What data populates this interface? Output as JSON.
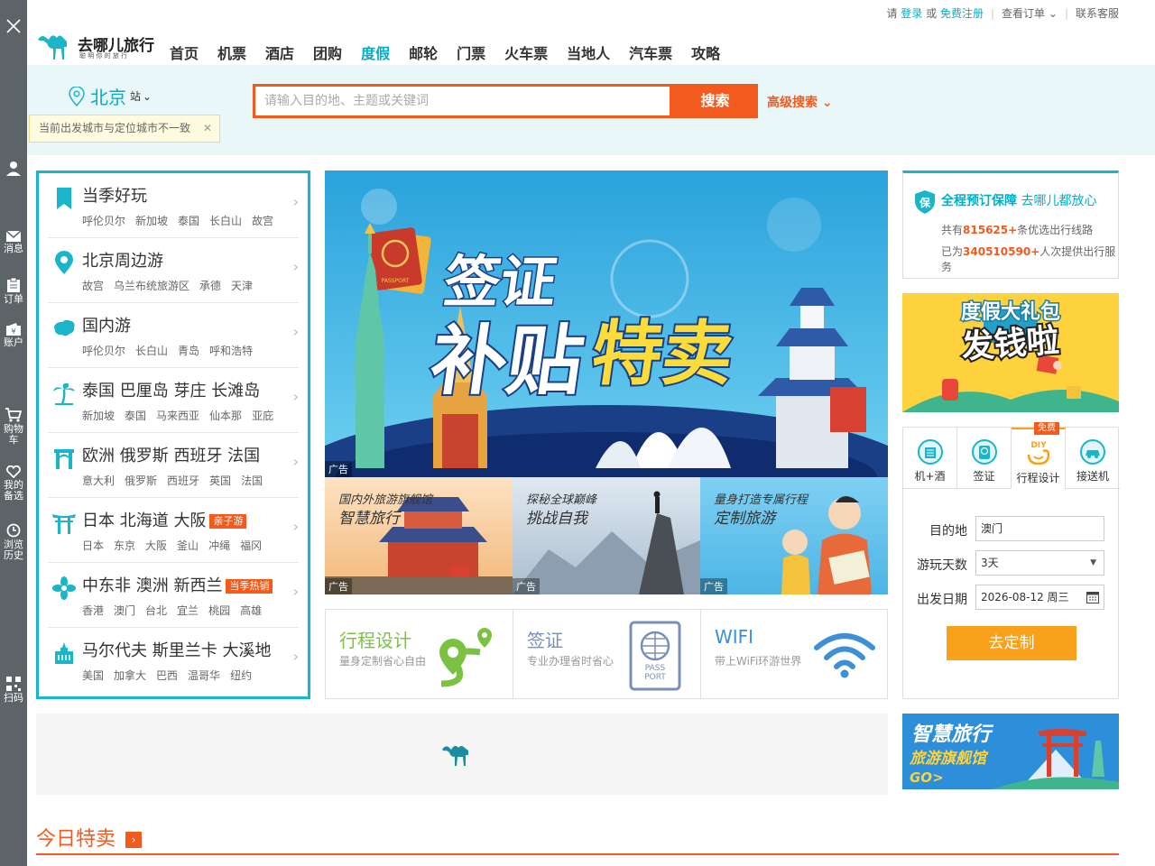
{
  "sidebar": {
    "items": [
      {
        "label": "消息",
        "icon": "mail-icon"
      },
      {
        "label": "订单",
        "icon": "clipboard-icon"
      },
      {
        "label": "账户",
        "icon": "wallet-icon"
      },
      {
        "label": "购物车",
        "icon": "cart-icon"
      },
      {
        "label": "我的备选",
        "icon": "heart-icon"
      },
      {
        "label": "浏览历史",
        "icon": "clock-icon"
      },
      {
        "label": "扫码",
        "icon": "qr-icon"
      }
    ]
  },
  "toplinks": {
    "please": "请",
    "login": "登录",
    "or": "或",
    "register": "免费注册",
    "orders": "查看订单",
    "service": "联系客服"
  },
  "logo": {
    "name": "去哪儿旅行",
    "slogan": "聪 明 你 的 旅 行"
  },
  "nav": [
    "首页",
    "机票",
    "酒店",
    "团购",
    "度假",
    "邮轮",
    "门票",
    "火车票",
    "当地人",
    "汽车票",
    "攻略"
  ],
  "nav_active": "度假",
  "city": {
    "name": "北京",
    "suffix": "站",
    "tip": "当前出发城市与定位城市不一致"
  },
  "search": {
    "placeholder": "请输入目的地、主题或关键词",
    "button": "搜索",
    "advanced": "高级搜索"
  },
  "categories": [
    {
      "title": "当季好玩",
      "badge": "",
      "subs": [
        "呼伦贝尔",
        "新加坡",
        "泰国",
        "长白山",
        "故宫"
      ]
    },
    {
      "title": "北京周边游",
      "badge": "",
      "subs": [
        "故宫",
        "乌兰布统旅游区",
        "承德",
        "天津"
      ]
    },
    {
      "title": "国内游",
      "badge": "",
      "subs": [
        "呼伦贝尔",
        "长白山",
        "青岛",
        "呼和浩特"
      ]
    },
    {
      "title": "泰国 巴厘岛 芽庄 长滩岛",
      "badge": "",
      "subs": [
        "新加坡",
        "泰国",
        "马来西亚",
        "仙本那",
        "亚庇"
      ]
    },
    {
      "title": "欧洲 俄罗斯 西班牙 法国",
      "badge": "",
      "subs": [
        "意大利",
        "俄罗斯",
        "西班牙",
        "英国",
        "法国"
      ]
    },
    {
      "title": "日本 北海道 大阪",
      "badge": "亲子游",
      "subs": [
        "日本",
        "东京",
        "大阪",
        "釜山",
        "冲绳",
        "福冈"
      ]
    },
    {
      "title": "中东非 澳洲 新西兰",
      "badge": "当季热销",
      "subs": [
        "香港",
        "澳门",
        "台北",
        "宜兰",
        "桃园",
        "高雄"
      ]
    },
    {
      "title": "马尔代夫 斯里兰卡 大溪地",
      "badge": "",
      "subs": [
        "美国",
        "加拿大",
        "巴西",
        "温哥华",
        "纽约"
      ]
    }
  ],
  "banner": {
    "line1": "签证",
    "line2a": "补贴",
    "line2b": "特卖",
    "ad": "广告",
    "passport": "PASSPORT"
  },
  "promos": [
    {
      "t1": "国内外旅游旗舰馆",
      "t2": "智慧旅行",
      "ad": "广告"
    },
    {
      "t1": "探秘全球巅峰",
      "t2": "挑战自我",
      "ad": "广告"
    },
    {
      "t1": "量身打造专属行程",
      "t2": "定制旅游",
      "ad": "广告"
    }
  ],
  "services": [
    {
      "name": "行程设计",
      "desc": "量身定制省心自由",
      "color": "#7cc242"
    },
    {
      "name": "签证",
      "desc": "专业办理省时省心",
      "color": "#7a8fb8"
    },
    {
      "name": "WIFI",
      "desc": "带上WiFi环游世界",
      "color": "#3d8fd6"
    }
  ],
  "passport_stamp": {
    "line1": "PASS",
    "line2": "PORT"
  },
  "guarantee": {
    "title_bold": "全程预订保障",
    "title_rest": "去哪儿都放心",
    "line1_pre": "共有",
    "line1_num": "815625+",
    "line1_post": "条优选出行线路",
    "line2_pre": "已为",
    "line2_num": "340510590+",
    "line2_post": "人次提供出行服务",
    "icon_char": "保"
  },
  "gift": {
    "line1": "度假大礼包",
    "line2": "发钱啦"
  },
  "tabs": [
    {
      "label": "机+酒",
      "icon": "hotel-icon"
    },
    {
      "label": "签证",
      "icon": "visa-icon"
    },
    {
      "label": "行程设计",
      "icon": "diy-icon",
      "badge": "免费"
    },
    {
      "label": "接送机",
      "icon": "car-icon"
    }
  ],
  "diy_tag": "DIY",
  "form": {
    "dest_label": "目的地",
    "dest_value": "澳门",
    "days_label": "游玩天数",
    "days_value": "3天",
    "date_label": "出发日期",
    "date_value": "2026-08-12 周三",
    "submit": "去定制"
  },
  "flagship": {
    "line1": "智慧旅行",
    "line2": "旅游旗舰馆",
    "line3": "GO>"
  },
  "today": {
    "title": "今日特卖"
  },
  "colors": {
    "accent": "#00afc7",
    "orange": "#f25a1e",
    "amber": "#f9a11b",
    "sidebar": "#5d6468"
  }
}
